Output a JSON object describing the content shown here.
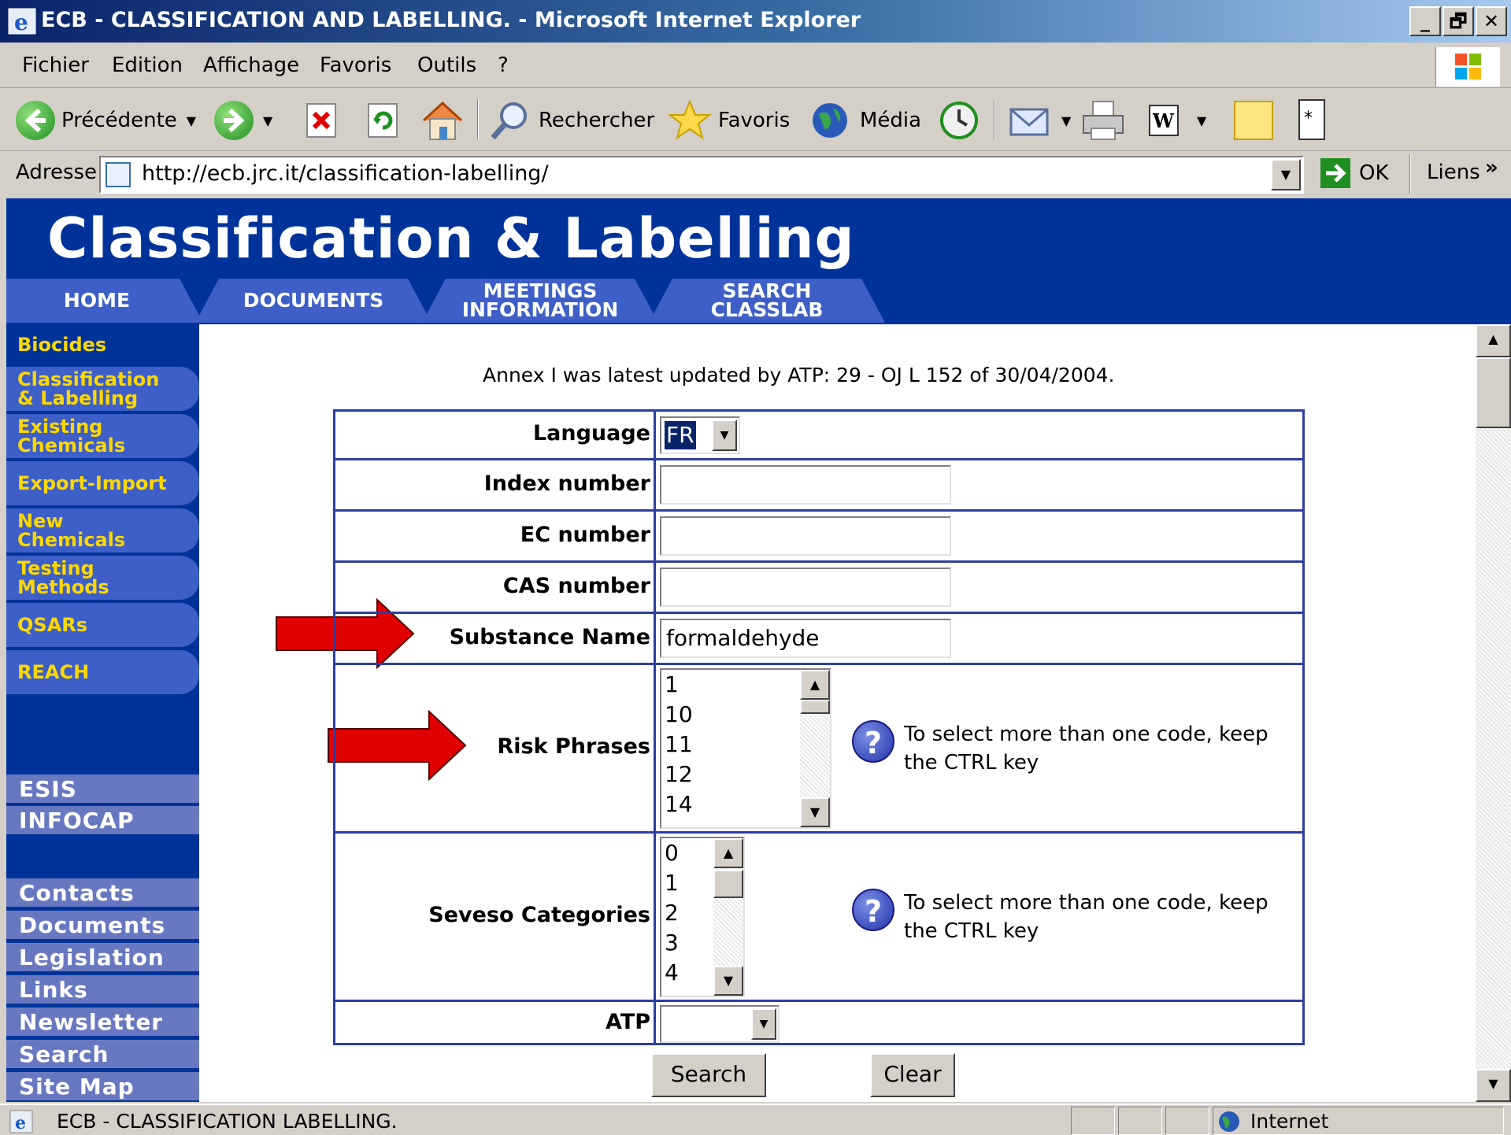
{
  "window": {
    "title": "ECB - CLASSIFICATION AND LABELLING. - Microsoft Internet Explorer",
    "minimize": "_",
    "maximize": "🗗",
    "close": "✕"
  },
  "menu": [
    "Fichier",
    "Edition",
    "Affichage",
    "Favoris",
    "Outils",
    "?"
  ],
  "toolbar": {
    "back": "Précédente",
    "search": "Rechercher",
    "favorites": "Favoris",
    "media": "Média"
  },
  "address": {
    "label": "Adresse",
    "url": "http://ecb.jrc.it/classification-labelling/",
    "go": "OK",
    "links": "Liens",
    "links_more": "»"
  },
  "page": {
    "banner_title": "Classification & Labelling",
    "tabs": [
      "HOME",
      "DOCUMENTS",
      "MEETINGS\nINFORMATION",
      "SEARCH\nCLASSLAB"
    ],
    "sidebar_top": [
      "Biocides",
      "Classification\n& Labelling",
      "Existing\nChemicals",
      "Export-Import",
      "New\nChemicals",
      "Testing\nMethods",
      "QSARs",
      "REACH"
    ],
    "sidebar_mid": [
      "ESIS",
      "INFOCAP"
    ],
    "sidebar_bottom": [
      "Contacts",
      "Documents",
      "Legislation",
      "Links",
      "Newsletter",
      "Search",
      "Site Map"
    ],
    "annex_note": "Annex I was latest updated by ATP: 29 - OJ L 152 of 30/04/2004."
  },
  "form": {
    "language_label": "Language",
    "language_value": "FR",
    "index_label": "Index number",
    "index_value": "",
    "ec_label": "EC number",
    "ec_value": "",
    "cas_label": "CAS number",
    "cas_value": "",
    "substance_label": "Substance Name",
    "substance_value": "formaldehyde",
    "risk_label": "Risk Phrases",
    "risk_options": [
      "1",
      "10",
      "11",
      "12",
      "14"
    ],
    "seveso_label": "Seveso Categories",
    "seveso_options": [
      "0",
      "1",
      "2",
      "3",
      "4"
    ],
    "help_text": "To select more than one code, keep the CTRL key",
    "atp_label": "ATP",
    "atp_value": "",
    "search_button": "Search",
    "clear_button": "Clear"
  },
  "status": {
    "text": "ECB - CLASSIFICATION LABELLING.",
    "zone": "Internet"
  },
  "colors": {
    "banner": "#003399",
    "tab": "#3d5fc7",
    "sidebar_highlight": "#ffd700",
    "table_border": "#2b3fa0",
    "arrow": "#e00000"
  }
}
